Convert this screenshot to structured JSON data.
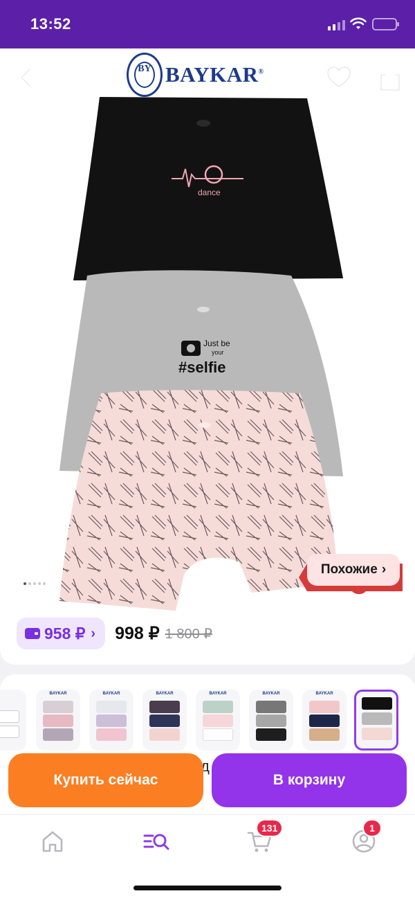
{
  "status_bar": {
    "time": "13:52"
  },
  "brand": {
    "name": "BAYKAR",
    "seal_text": "BY"
  },
  "product": {
    "print_1": "dance",
    "print_2_line1": "Just be",
    "print_2_line2": "your",
    "print_2_tag": "#selfie"
  },
  "carousel": {
    "pages": 5,
    "active_page": 1
  },
  "similar_button": {
    "label": "Похожие"
  },
  "price": {
    "bonus_price": "958 ₽",
    "current": "998 ₽",
    "old": "1 800 ₽"
  },
  "variants": {
    "thumb_brand": "BAYKAR",
    "count_visible": 8,
    "selected_index": 7
  },
  "actions": {
    "buy_now": "Купить сейчас",
    "add_to_cart": "В корзину",
    "partial_text": "д"
  },
  "tabbar": {
    "cart_badge": "131",
    "profile_badge": "1"
  },
  "colors": {
    "status_bar": "#5b1fa8",
    "accent_purple": "#9333ea",
    "accent_orange": "#fb7e23",
    "badge_red": "#e8284a"
  }
}
